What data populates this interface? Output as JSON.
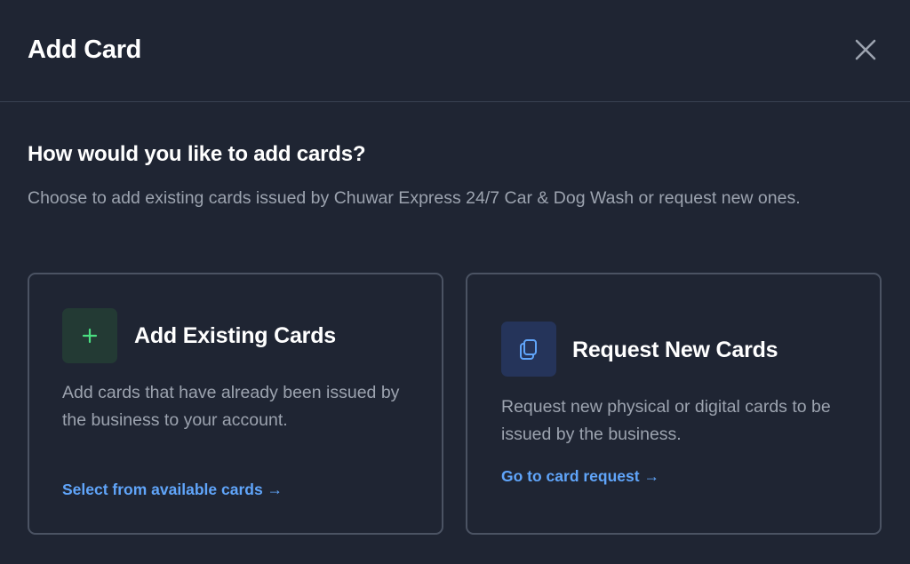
{
  "modal": {
    "title": "Add Card",
    "close_icon": "close-icon"
  },
  "intro": {
    "question": "How would you like to add cards?",
    "description": "Choose to add existing cards issued by Chuwar Express 24/7 Car & Dog Wash or request new ones."
  },
  "options": [
    {
      "icon": "plus-icon",
      "icon_color": "#4ade80",
      "title": "Add Existing Cards",
      "text": "Add cards that have already been issued by the business to your account.",
      "link": "Select from available cards →"
    },
    {
      "icon": "copy-cards-icon",
      "icon_color": "#60a5fa",
      "title": "Request New Cards",
      "text": "Request new physical or digital cards to be issued by the business.",
      "link": "Go to card request →"
    }
  ],
  "colors": {
    "background": "#1f2533",
    "border": "#4b5363",
    "accent_link": "#60a5fa",
    "muted_text": "#9ca3af"
  }
}
